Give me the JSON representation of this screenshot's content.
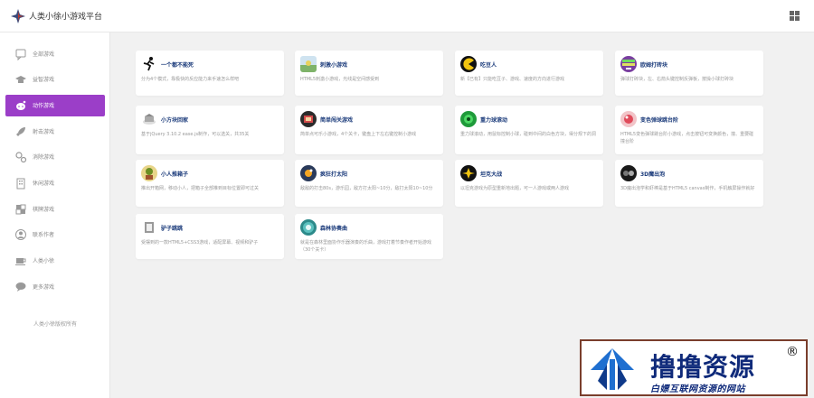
{
  "header": {
    "title": "人类小徐小游戏平台"
  },
  "sidebar": {
    "items": [
      {
        "label": "全部游戏",
        "icon": "chat-bubble-icon"
      },
      {
        "label": "益智游戏",
        "icon": "graduation-cap-icon"
      },
      {
        "label": "动作游戏",
        "icon": "reddit-alien-icon",
        "active": true
      },
      {
        "label": "射击游戏",
        "icon": "rocket-icon"
      },
      {
        "label": "消除游戏",
        "icon": "gears-icon"
      },
      {
        "label": "休闲游戏",
        "icon": "building-icon"
      },
      {
        "label": "棋牌游戏",
        "icon": "puzzle-icon"
      },
      {
        "label": "联系作者",
        "icon": "user-circle-icon"
      },
      {
        "label": "人类小徐",
        "icon": "coffee-icon"
      },
      {
        "label": "更多游戏",
        "icon": "speech-icon"
      }
    ],
    "copyright": "人类小徐版权所有"
  },
  "games": [
    {
      "title": "一个都不能死",
      "desc": "分为4个模式，靠极快的反应能力来手速怎么样吧",
      "icon": "runner-icon"
    },
    {
      "title": "刺激小游戏",
      "desc": "HTML5刺激小游戏，光线是空间感受到",
      "icon": "game-thumb-icon"
    },
    {
      "title": "吃豆人",
      "desc": "新【已有】只能吃豆子、游戏、速度的方向进行游戏",
      "icon": "pacman-icon"
    },
    {
      "title": "欧姆打砖块",
      "desc": "弹球打砖块，左、右箭头键控制反弹板，按操小球打砖块",
      "icon": "bricks-icon"
    },
    {
      "title": "小方块回家",
      "desc": "基于jQuery 3.10.2 ease.js制作，可以选关，共35关",
      "icon": "cube-icon"
    },
    {
      "title": "简单闯关游戏",
      "desc": "简单点可乐小游戏，4个关卡，键盘上下左右键控制小游戏",
      "icon": "level-icon"
    },
    {
      "title": "重力球滚动",
      "desc": "重力球滚动，用鼠标控制小球，碰到中间的白色方块，得分规下的洞",
      "icon": "gravity-ball-icon"
    },
    {
      "title": "变色弹球跳台阶",
      "desc": "HTML5变色弹球跳台阶小游戏，点击按钮可变换颜色，撞、重要碰撞台阶",
      "icon": "color-ball-icon"
    },
    {
      "title": "小人推箱子",
      "desc": "推出开箱网，移动小人，把箱子全部推到目标位置即可过关",
      "icon": "sokoban-icon"
    },
    {
      "title": "疯狂打太阳",
      "desc": "敌敌的打击80s，游乐园，敌方打太阳~10分，敌打太阳10~10分",
      "icon": "sun-icon"
    },
    {
      "title": "坦克大战",
      "desc": "以坦克游戏为原型重新地出题，可一人游戏或两人游戏",
      "icon": "tank-icon"
    },
    {
      "title": "3D魔出泡",
      "desc": "3D魔出泡学和虾棒是基于HTML5 canvas制作，手机触屏操作就好",
      "icon": "bubble-3d-icon"
    },
    {
      "title": "驴子跳跳",
      "desc": "受摆到的一款HTML5+CSS3游戏，适配屏幕、视频和驴子",
      "icon": "donkey-icon"
    },
    {
      "title": "森林协奏曲",
      "desc": "就是在森林里面协作乐器演奏的乐曲，游戏打着节奏作者开始游戏（30个关卡）",
      "icon": "forest-icon"
    }
  ],
  "watermark": {
    "title": "撸撸资源",
    "reg": "®",
    "subtitle": "白嫖互联网资源的网站"
  },
  "colors": {
    "accent": "#9b3ec8",
    "card_title": "#1a3a7a",
    "watermark_blue": "#0f2a7a",
    "watermark_border": "#7a3e2c"
  }
}
